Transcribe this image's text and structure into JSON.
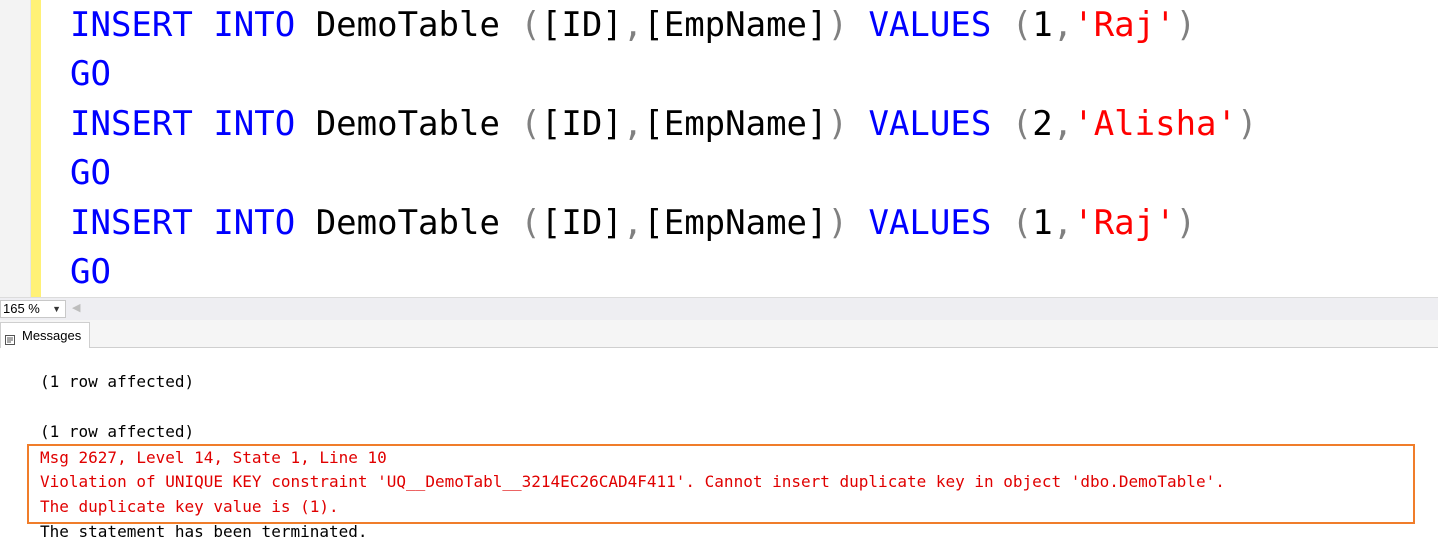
{
  "editor": {
    "lines": [
      {
        "kw1": "INSERT",
        "kw2": "INTO",
        "table": "DemoTable",
        "open": "(",
        "col1": "[ID]",
        "comma1": ",",
        "col2": "[EmpName]",
        "close": ")",
        "kw3": "VALUES",
        "vopen": "(",
        "num": "1",
        "comma2": ",",
        "str": "'Raj'",
        "vclose": ")"
      },
      {
        "go": "GO"
      },
      {
        "kw1": "INSERT",
        "kw2": "INTO",
        "table": "DemoTable",
        "open": "(",
        "col1": "[ID]",
        "comma1": ",",
        "col2": "[EmpName]",
        "close": ")",
        "kw3": "VALUES",
        "vopen": "(",
        "num": "2",
        "comma2": ",",
        "str": "'Alisha'",
        "vclose": ")"
      },
      {
        "go": "GO"
      },
      {
        "kw1": "INSERT",
        "kw2": "INTO",
        "table": "DemoTable",
        "open": "(",
        "col1": "[ID]",
        "comma1": ",",
        "col2": "[EmpName]",
        "close": ")",
        "kw3": "VALUES",
        "vopen": "(",
        "num": "1",
        "comma2": ",",
        "str": "'Raj'",
        "vclose": ")"
      },
      {
        "go": "GO"
      }
    ]
  },
  "zoom": {
    "value": "165 %"
  },
  "tabs": [
    {
      "label": "Messages",
      "icon": "messages-icon"
    }
  ],
  "messages": {
    "lines": [
      "(1 row affected)",
      "(1 row affected)",
      "Msg 2627, Level 14, State 1, Line 10",
      "Violation of UNIQUE KEY constraint 'UQ__DemoTabl__3214EC26CAD4F411'. Cannot insert duplicate key in object 'dbo.DemoTable'.",
      "The duplicate key value is (1).",
      "The statement has been terminated."
    ]
  },
  "colors": {
    "keyword": "#0000ff",
    "string": "#ff0000",
    "error": "#e00000",
    "highlight": "#f07d2a",
    "change_bar": "#fff176"
  }
}
